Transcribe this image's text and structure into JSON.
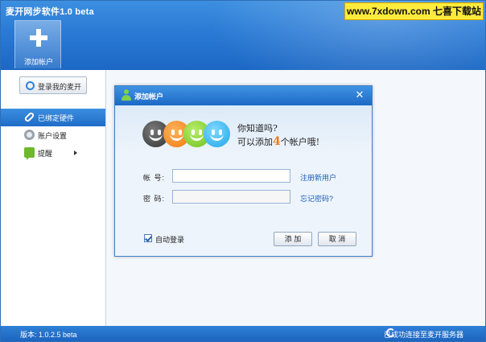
{
  "window": {
    "title": "麦开网步软件1.0 beta"
  },
  "watermark": {
    "text": "www.7xdown.com 七喜下载站"
  },
  "toolbar": {
    "add_account_label": "添加帐户"
  },
  "sidebar": {
    "login_button": "登录我的麦开",
    "items": [
      {
        "label": "已绑定硬件",
        "icon": "paperclip-icon",
        "active": true
      },
      {
        "label": "账户设置",
        "icon": "gear-icon",
        "active": false
      },
      {
        "label": "提醒",
        "icon": "chat-icon",
        "active": false
      }
    ]
  },
  "dialog": {
    "title": "添加帐户",
    "banner": {
      "line1": "你知道吗?",
      "line2_prefix": "可以添加",
      "line2_number": "4",
      "line2_suffix": "个帐户哦!"
    },
    "account_label": "帐  号:",
    "account_value": "",
    "password_label": "密  码:",
    "password_value": "",
    "register_link": "注册新用户",
    "forgot_link": "忘记密码?",
    "auto_login_label": "自动登录",
    "auto_login_checked": true,
    "add_button": "添 加",
    "cancel_button": "取 消"
  },
  "statusbar": {
    "version": "版本: 1.0.2.5 beta",
    "status": "已成功连接至麦开服务器"
  }
}
